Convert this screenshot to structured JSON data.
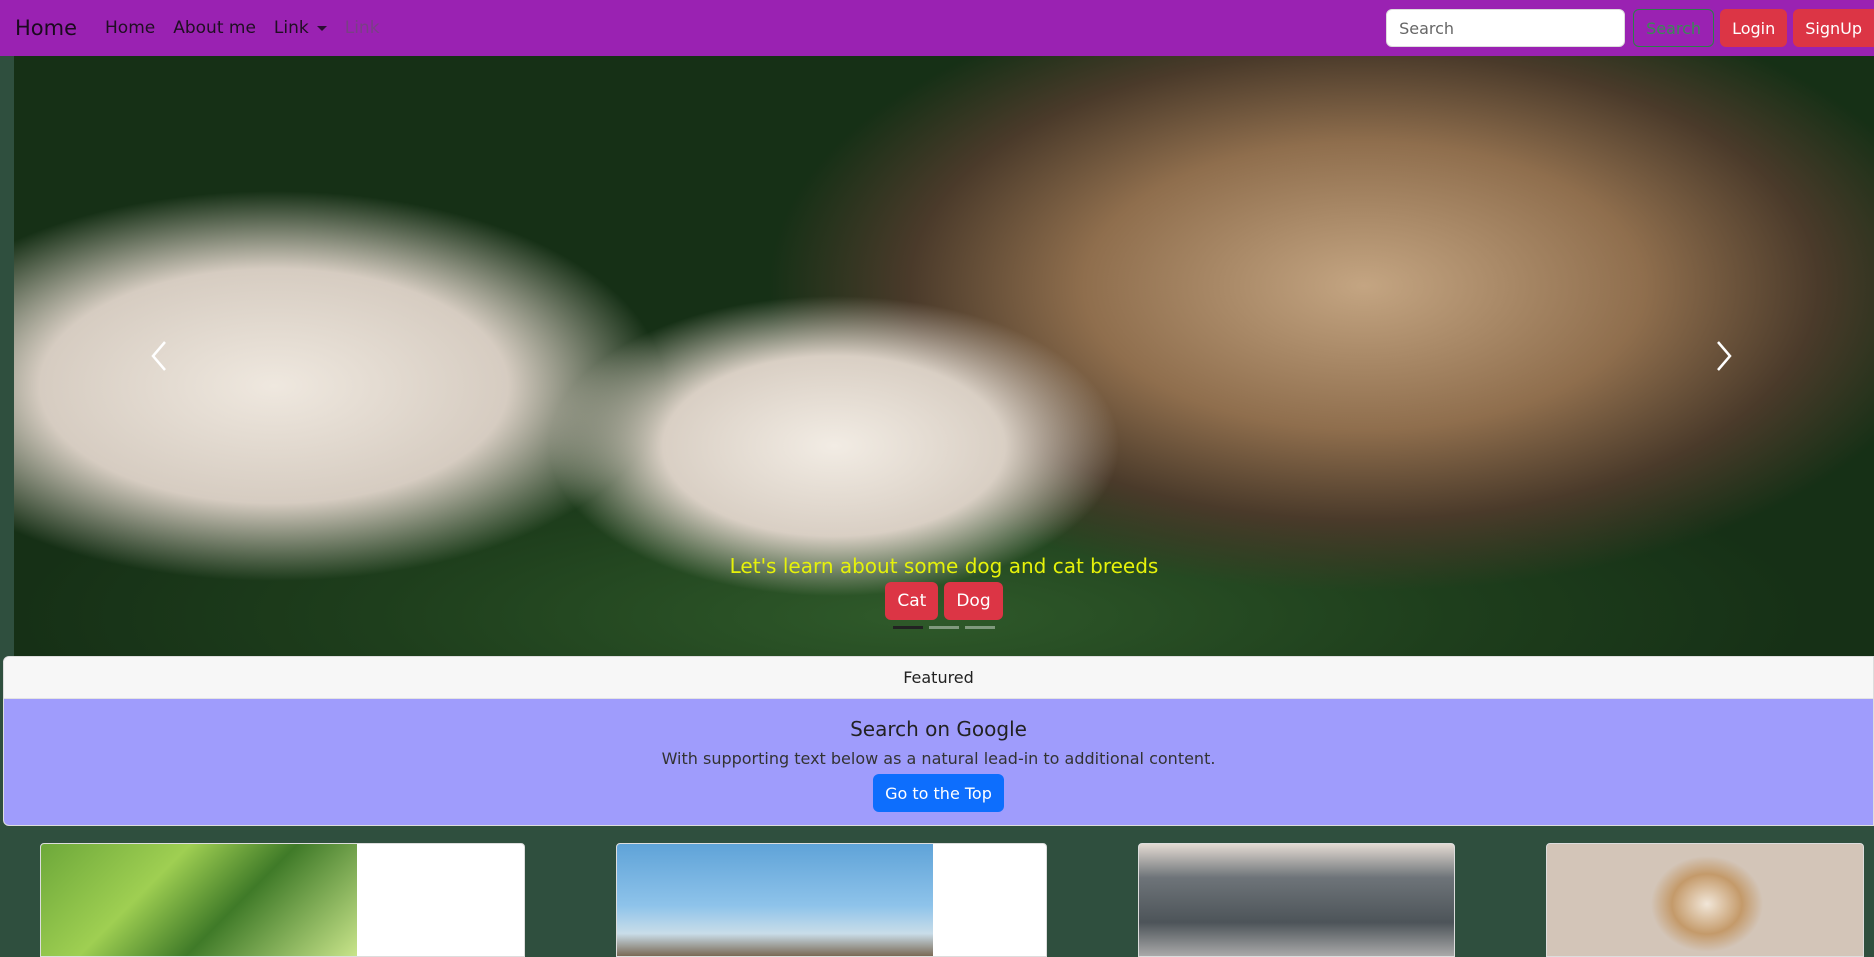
{
  "navbar": {
    "brand": "Home",
    "links": [
      {
        "label": "Home"
      },
      {
        "label": "About me"
      },
      {
        "label": "Link"
      },
      {
        "label": "Link"
      }
    ],
    "search_placeholder": "Search",
    "search_button": "Search",
    "login_button": "Login",
    "signup_button": "SignUp",
    "color": "#9a22b2"
  },
  "carousel": {
    "caption": "Let's learn about some dog and cat breeds",
    "buttons": [
      "Cat",
      "Dog"
    ],
    "indicator_count": 3,
    "active_indicator": 0,
    "prev_icon": "chevron-left-icon",
    "next_icon": "chevron-right-icon"
  },
  "featured": {
    "header": "Featured",
    "title": "Search on Google",
    "text": "With supporting text below as a natural lead-in to additional content.",
    "button": "Go to the Top",
    "body_color": "#9f9cfc"
  },
  "thumbnails": [
    {
      "name": "garden-photo"
    },
    {
      "name": "dog-field-photo"
    },
    {
      "name": "couch-photo"
    },
    {
      "name": "bulldog-puppy-photo"
    }
  ],
  "colors": {
    "background": "#2f4f3e",
    "danger": "#dc3545",
    "primary": "#0d6efd",
    "caption": "#e6f20a"
  }
}
